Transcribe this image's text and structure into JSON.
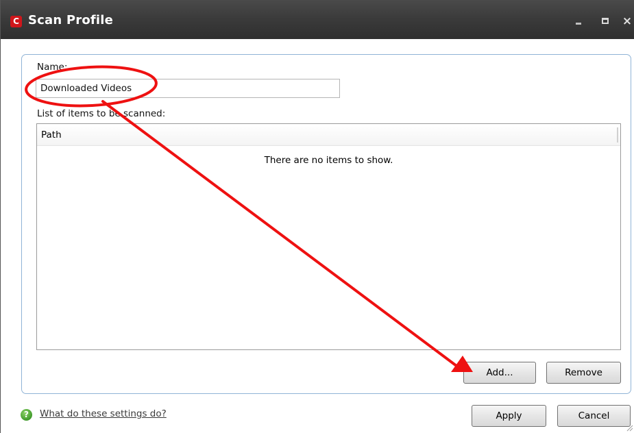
{
  "window": {
    "title": "Scan Profile",
    "logo_letter": "C",
    "controls": {
      "minimize": "minimize",
      "maximize": "maximize",
      "close": "×"
    }
  },
  "form": {
    "name_label": "Name:",
    "name_value": "Downloaded Videos",
    "list_label": "List of items to be scanned:",
    "list": {
      "columns": [
        "Path"
      ],
      "rows": [],
      "empty_message": "There are no items to show."
    },
    "add_button": "Add...",
    "remove_button": "Remove"
  },
  "footer": {
    "help_icon_glyph": "?",
    "help_link": "What do these settings do?",
    "apply_button": "Apply",
    "cancel_button": "Cancel"
  },
  "icons": {
    "app_logo": "comodo-logo-icon",
    "help": "help-icon",
    "resize": "resize-grip-icon"
  },
  "colors": {
    "titlebar": "#3a3a3a",
    "logo": "#d0161b",
    "group_border": "#8fb3d6",
    "annotation": "#ee1111",
    "help_icon": "#3f9a2a"
  }
}
